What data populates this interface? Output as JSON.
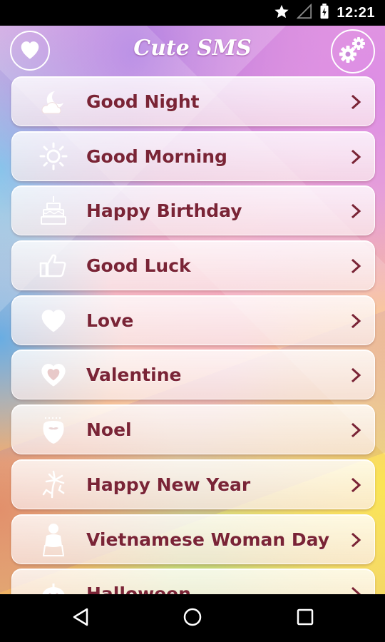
{
  "status_bar": {
    "time": "12:21",
    "icons": [
      "star-icon",
      "signal-icon",
      "battery-icon"
    ]
  },
  "header": {
    "title": "Cute SMS",
    "left_icon": "heart-icon",
    "right_icon": "gear-icon"
  },
  "menu": {
    "items": [
      {
        "label": "Good Night",
        "icon": "moon-cloud-icon"
      },
      {
        "label": "Good Morning",
        "icon": "sun-icon"
      },
      {
        "label": "Happy Birthday",
        "icon": "cake-icon"
      },
      {
        "label": "Good Luck",
        "icon": "thumbs-up-icon"
      },
      {
        "label": "Love",
        "icon": "heart-icon"
      },
      {
        "label": "Valentine",
        "icon": "valentine-heart-icon"
      },
      {
        "label": "Noel",
        "icon": "santa-beard-icon"
      },
      {
        "label": "Happy New Year",
        "icon": "fireworks-icon"
      },
      {
        "label": "Vietnamese Woman Day",
        "icon": "woman-ao-dai-icon"
      },
      {
        "label": "Halloween",
        "icon": "pumpkin-icon"
      }
    ]
  },
  "nav_bar": {
    "icons": [
      "back-icon",
      "home-icon",
      "recents-icon"
    ]
  },
  "colors": {
    "label": "#7a2436",
    "icon": "#ffffff",
    "status_bar": "#000000"
  }
}
